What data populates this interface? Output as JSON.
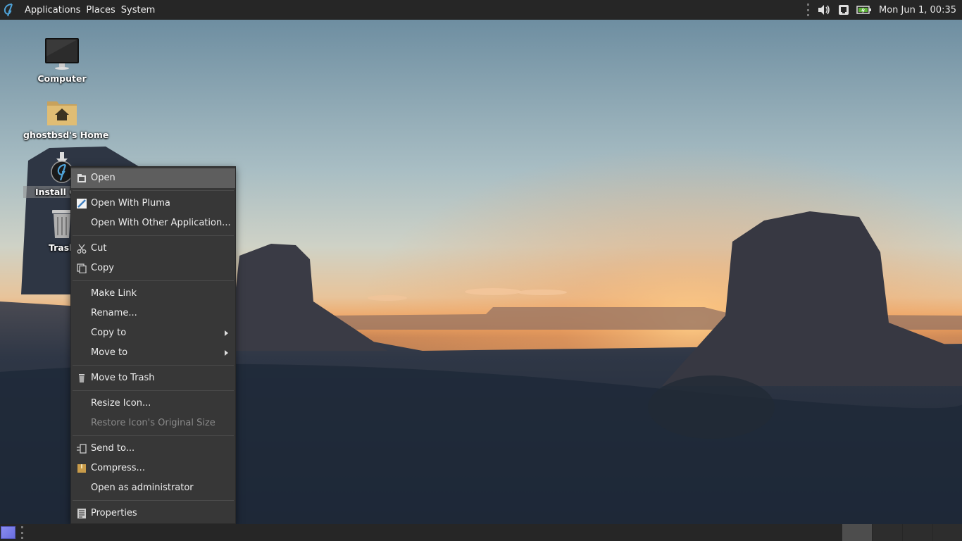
{
  "top_panel": {
    "menus": [
      "Applications",
      "Places",
      "System"
    ],
    "clock": "Mon Jun  1, 00:35",
    "tray_icons": [
      "volume-icon",
      "network-icon",
      "battery-icon"
    ]
  },
  "desktop": {
    "icons": [
      {
        "label": "Computer",
        "icon": "computer-icon"
      },
      {
        "label": "ghostbsd's Home",
        "icon": "home-folder-icon"
      },
      {
        "label": "Install Gho",
        "icon": "installer-icon",
        "selected": true
      },
      {
        "label": "Trash",
        "icon": "trash-icon"
      }
    ]
  },
  "context_menu": {
    "items": [
      {
        "label": "Open",
        "icon": "open-icon",
        "highlighted": true
      },
      {
        "label": "Open With Pluma",
        "icon": "pluma-icon"
      },
      {
        "label": "Open With Other Application...",
        "icon": ""
      },
      {
        "label": "Cut",
        "icon": "scissors-icon"
      },
      {
        "label": "Copy",
        "icon": "copy-icon"
      },
      {
        "label": "Make Link",
        "icon": ""
      },
      {
        "label": "Rename...",
        "icon": ""
      },
      {
        "label": "Copy to",
        "icon": "",
        "submenu": true
      },
      {
        "label": "Move to",
        "icon": "",
        "submenu": true
      },
      {
        "label": "Move to Trash",
        "icon": "trash-icon"
      },
      {
        "label": "Resize Icon...",
        "icon": ""
      },
      {
        "label": "Restore Icon's Original Size",
        "icon": "",
        "disabled": true
      },
      {
        "label": "Send to...",
        "icon": "send-icon"
      },
      {
        "label": "Compress...",
        "icon": "archive-icon"
      },
      {
        "label": "Open as administrator",
        "icon": ""
      },
      {
        "label": "Properties",
        "icon": "properties-icon"
      }
    ]
  },
  "colors": {
    "panel_bg": "#262626",
    "menu_bg": "#373737",
    "menu_highlight": "#5e5e5e",
    "menu_text": "#ededed",
    "menu_disabled_text": "#8a8a8a"
  }
}
